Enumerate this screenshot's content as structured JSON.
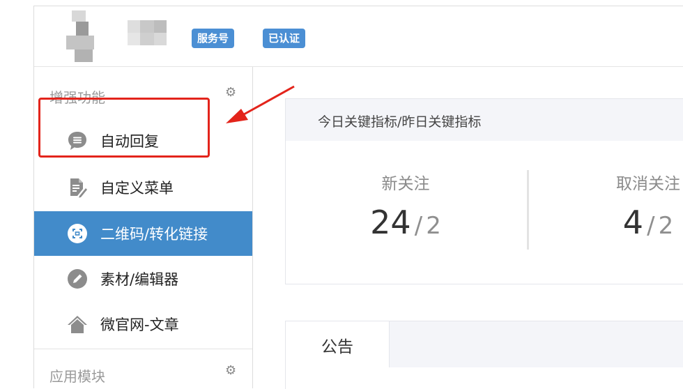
{
  "header": {
    "badges": {
      "service": "服务号",
      "verified": "已认证"
    }
  },
  "sidebar": {
    "sections": [
      {
        "title": "增强功能",
        "icon": "gear-icon"
      },
      {
        "title": "应用模块",
        "icon": "gear-icon"
      }
    ],
    "items": [
      {
        "label": "自动回复",
        "icon": "chat-bubble-icon",
        "active": false
      },
      {
        "label": "自定义菜单",
        "icon": "document-edit-icon",
        "active": false
      },
      {
        "label": "二维码/转化链接",
        "icon": "qrcode-scan-icon",
        "active": true
      },
      {
        "label": "素材/编辑器",
        "icon": "pencil-icon",
        "active": false
      },
      {
        "label": "微官网-文章",
        "icon": "home-icon",
        "active": false
      }
    ]
  },
  "stats": {
    "title": "今日关键指标/昨日关键指标",
    "separator": "/",
    "metrics": [
      {
        "label": "新关注",
        "today": "24",
        "yesterday": "2"
      },
      {
        "label": "取消关注",
        "today": "4",
        "yesterday": "2"
      }
    ]
  },
  "notice": {
    "tab": "公告"
  },
  "colors": {
    "accent": "#428bca",
    "badge": "#4b8fd4",
    "annotation_red": "#e3241b"
  }
}
